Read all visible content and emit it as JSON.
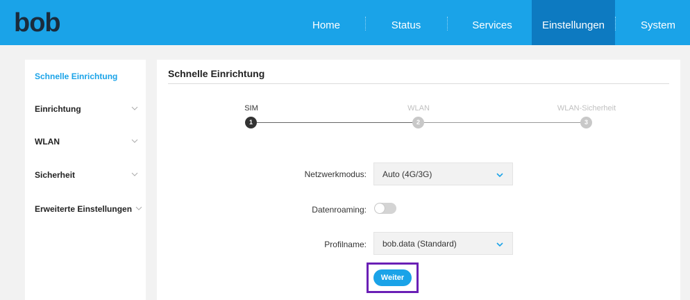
{
  "brand": {
    "logo_text": "bob"
  },
  "nav": {
    "items": [
      {
        "label": "Home"
      },
      {
        "label": "Status"
      },
      {
        "label": "Services"
      },
      {
        "label": "Einstellungen",
        "active": true
      },
      {
        "label": "System"
      }
    ]
  },
  "sidebar": {
    "items": [
      {
        "label": "Schnelle Einrichtung",
        "active": true
      },
      {
        "label": "Einrichtung",
        "icon": "chevron-down-icon"
      },
      {
        "label": "WLAN",
        "icon": "chevron-down-icon"
      },
      {
        "label": "Sicherheit",
        "icon": "chevron-down-icon"
      },
      {
        "label": "Erweiterte Einstellungen",
        "icon": "chevron-down-icon"
      }
    ]
  },
  "main": {
    "title": "Schnelle Einrichtung",
    "steps": [
      {
        "label": "SIM",
        "number": "1",
        "state": "active"
      },
      {
        "label": "WLAN",
        "number": "2",
        "state": "inactive"
      },
      {
        "label": "WLAN-Sicherheit",
        "number": "3",
        "state": "inactive"
      }
    ],
    "form": {
      "network_mode_label": "Netzwerkmodus:",
      "network_mode_value": "Auto (4G/3G)",
      "roaming_label": "Datenroaming:",
      "roaming_on": false,
      "profile_label": "Profilname:",
      "profile_value": "bob.data (Standard)",
      "next_button": "Weiter"
    }
  },
  "colors": {
    "header": "#1aa3e8",
    "nav_active": "#0d7ac1",
    "accent": "#1aa3e8",
    "step_active": "#333333",
    "step_inactive": "#c8c8c8",
    "highlight": "#6a1fb5"
  }
}
